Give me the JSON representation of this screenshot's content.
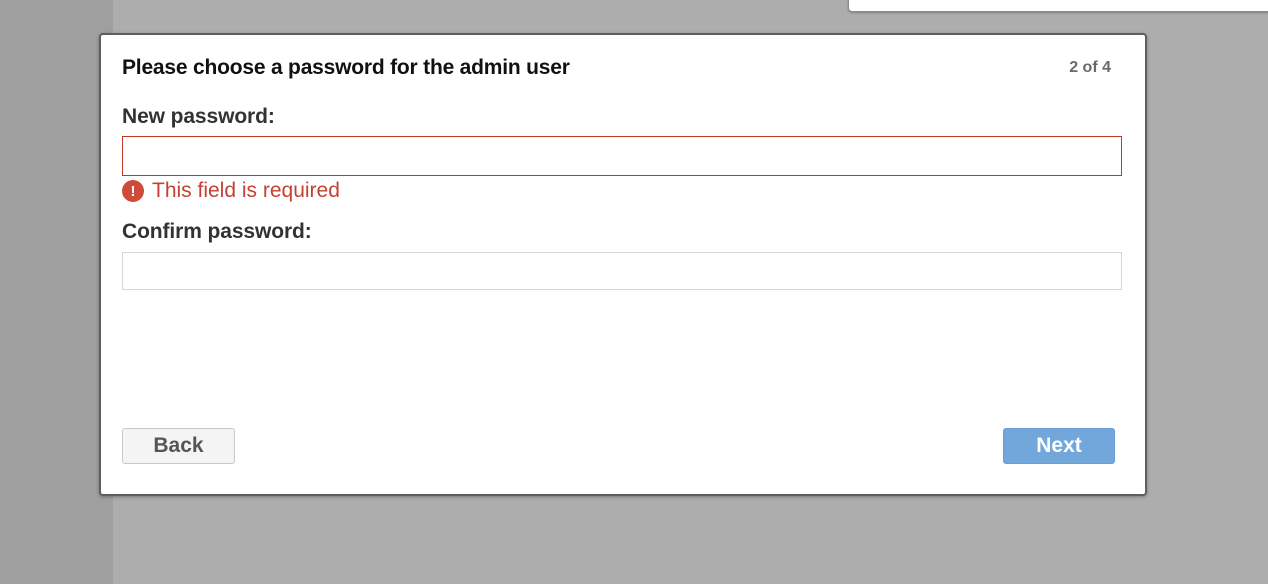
{
  "dialog": {
    "title": "Please choose a password for the admin user",
    "step": "2 of 4"
  },
  "form": {
    "new_password": {
      "label": "New password:",
      "value": "",
      "error": "This field is required",
      "error_icon": "exclamation-circle-icon"
    },
    "confirm_password": {
      "label": "Confirm password:",
      "value": ""
    }
  },
  "actions": {
    "back_label": "Back",
    "next_label": "Next"
  },
  "colors": {
    "error": "#c44233",
    "primary": "#72a7dc",
    "overlay": "#adadad"
  }
}
